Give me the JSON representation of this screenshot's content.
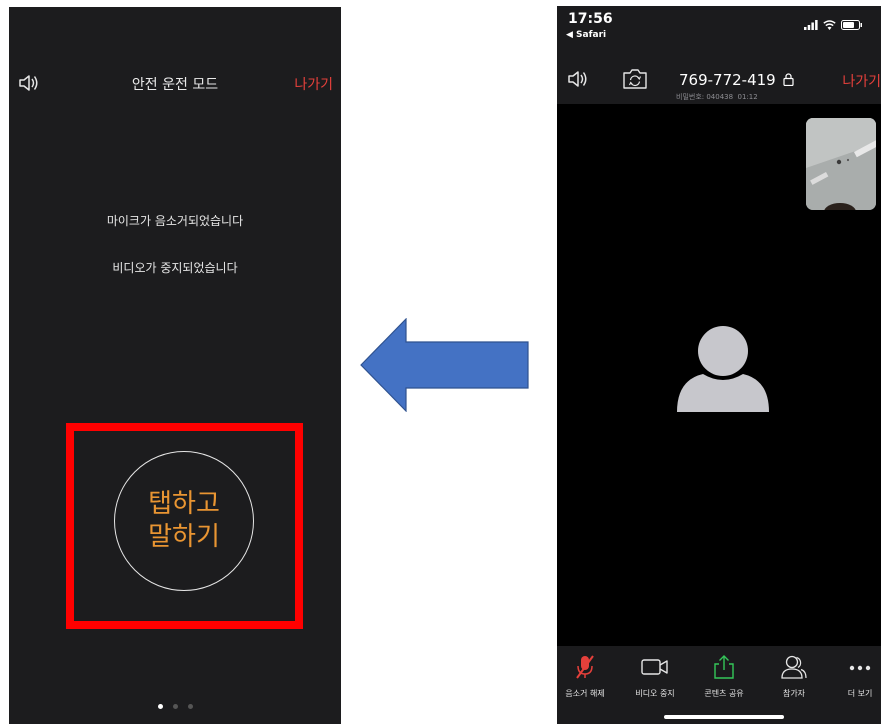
{
  "left": {
    "title": "안전 운전 모드",
    "exit": "나가기",
    "mic_status": "마이크가 음소거되었습니다",
    "video_status": "비디오가 중지되었습니다",
    "tap_line1": "탭하고",
    "tap_line2": "말하기",
    "accent": "#e99532",
    "highlight_color": "#ff0000"
  },
  "arrow": {
    "color": "#4472c4",
    "direction": "left"
  },
  "right": {
    "time": "17:56",
    "back": "◀ Safari",
    "meeting_id": "769-772-419",
    "password_label": "비밀번호: 040438",
    "elapsed": "01:12",
    "exit": "나가기",
    "toolbar": {
      "unmute": "음소거 해제",
      "stop_video": "비디오 중지",
      "share": "콘텐츠 공유",
      "participants": "참가자",
      "more": "더 보기"
    }
  }
}
